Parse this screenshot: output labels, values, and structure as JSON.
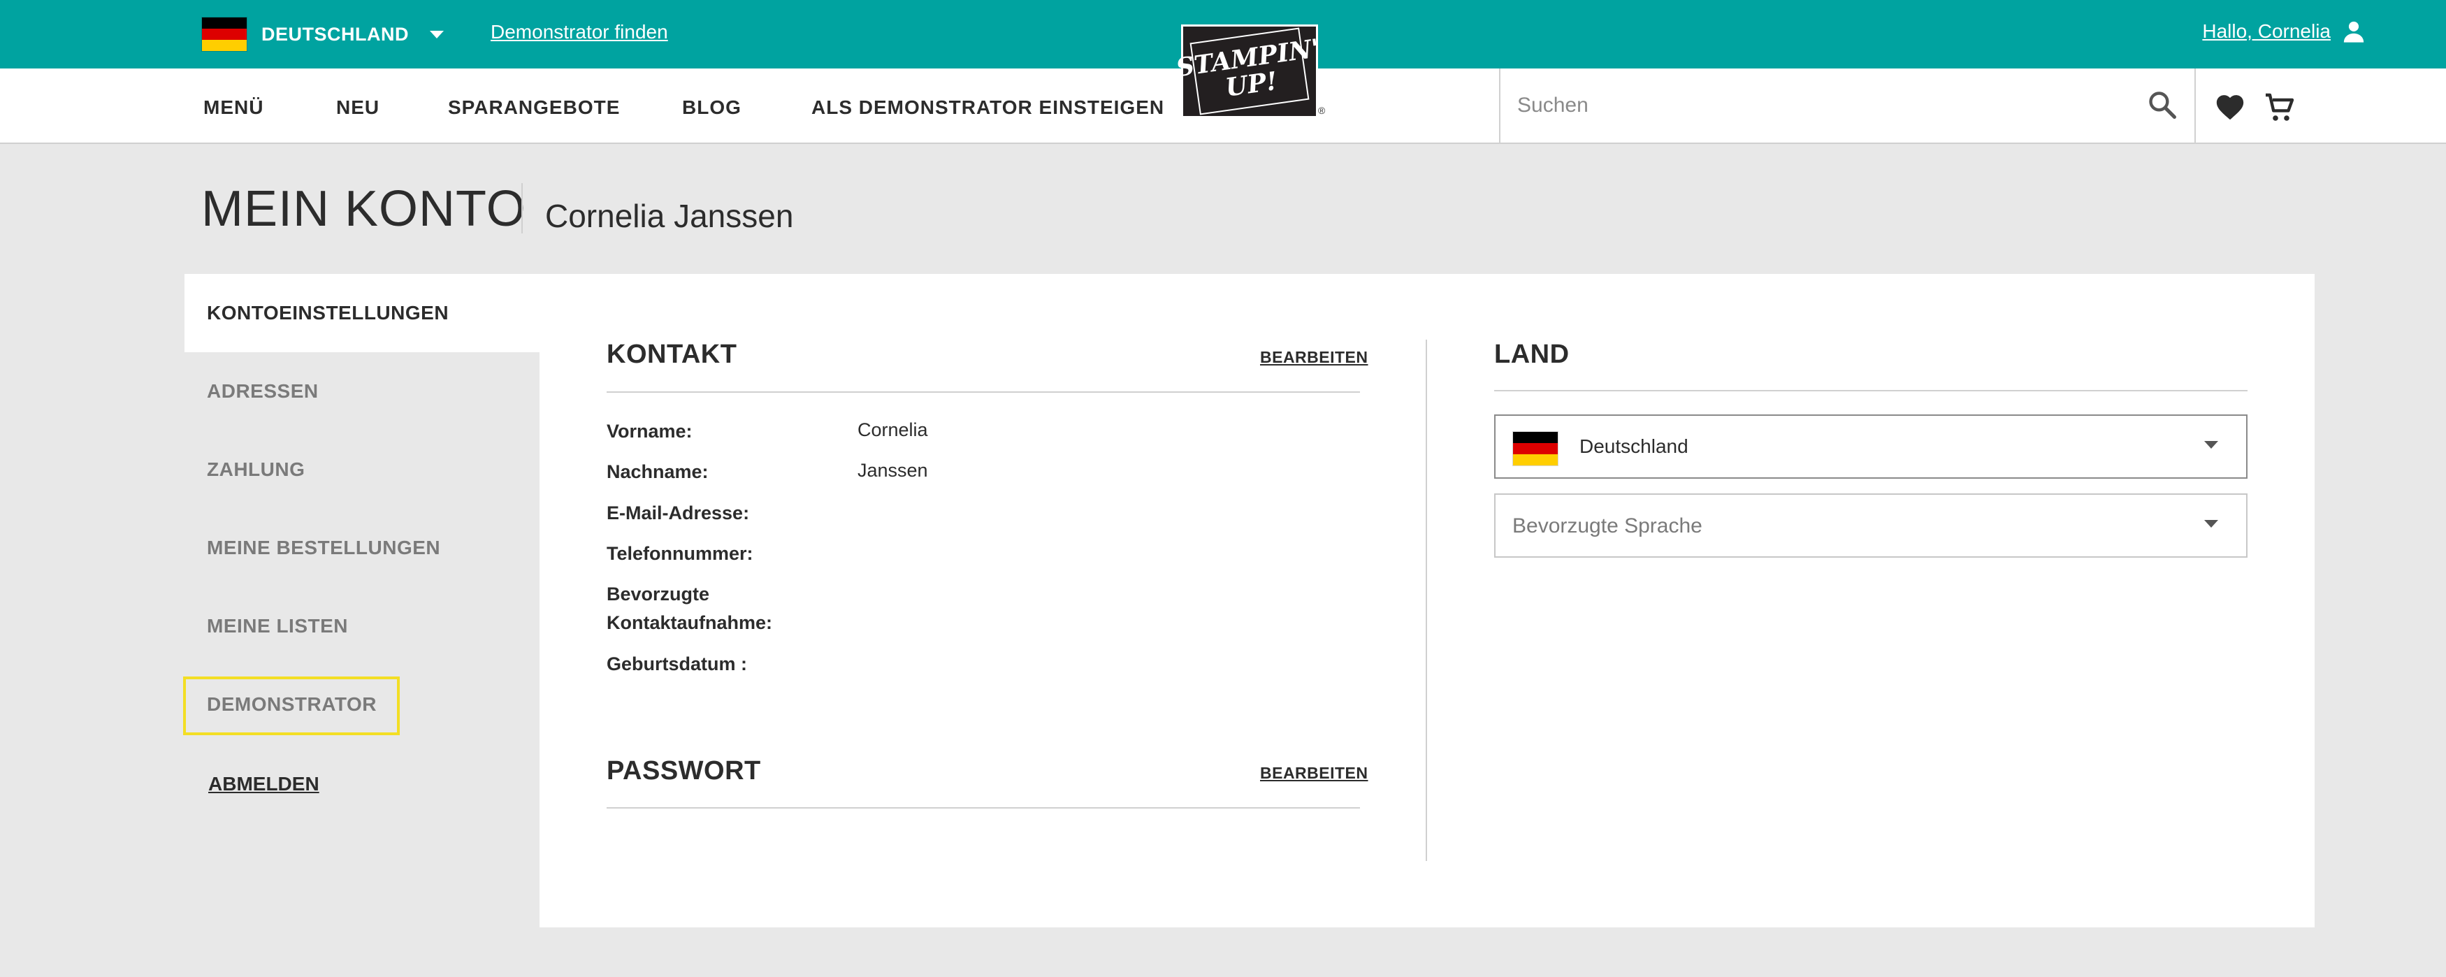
{
  "topbar": {
    "country_label": "DEUTSCHLAND",
    "demonstrator_find": "Demonstrator finden",
    "greeting": "Hallo, Cornelia"
  },
  "logo": {
    "line1": "STAMPIN'",
    "line2": "UP!",
    "reg": "®"
  },
  "nav": {
    "items": [
      "MENÜ",
      "NEU",
      "SPARANGEBOTE",
      "BLOG",
      "ALS DEMONSTRATOR EINSTEIGEN"
    ],
    "search_placeholder": "Suchen"
  },
  "page": {
    "title": "MEIN KONTO",
    "user_name": "Cornelia Janssen"
  },
  "sidebar": {
    "active": "KONTOEINSTELLUNGEN",
    "items": [
      "ADRESSEN",
      "ZAHLUNG",
      "MEINE BESTELLUNGEN",
      "MEINE LISTEN",
      "DEMONSTRATOR"
    ],
    "logout": "ABMELDEN"
  },
  "kontakt": {
    "title": "KONTAKT",
    "edit": "BEARBEITEN",
    "fields": [
      {
        "label": "Vorname:",
        "value": "Cornelia"
      },
      {
        "label": "Nachname:",
        "value": "Janssen"
      },
      {
        "label": "E-Mail-Adresse:",
        "value": ""
      },
      {
        "label": "Telefonnummer:",
        "value": ""
      },
      {
        "label_line1": "Bevorzugte",
        "label_line2": "Kontaktaufnahme:",
        "value": ""
      },
      {
        "label": "Geburtsdatum :",
        "value": ""
      }
    ]
  },
  "passwort": {
    "title": "PASSWORT",
    "edit": "BEARBEITEN"
  },
  "land": {
    "title": "LAND",
    "country_selected": "Deutschland",
    "language_placeholder": "Bevorzugte Sprache"
  },
  "colors": {
    "topbar": "#00a3a0",
    "highlight": "#f3de24"
  }
}
